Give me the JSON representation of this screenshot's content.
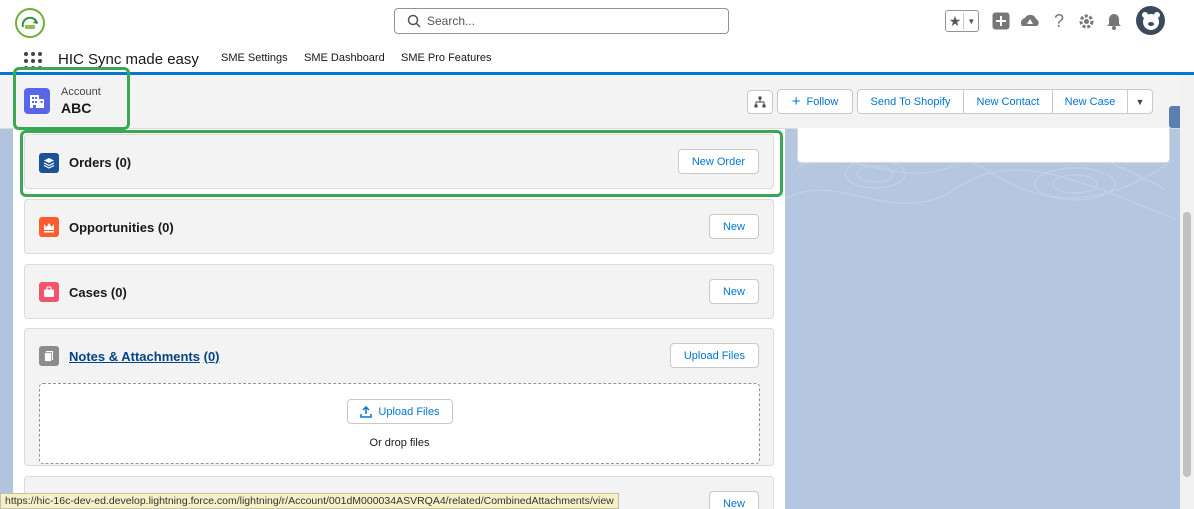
{
  "search": {
    "placeholder": "Search..."
  },
  "app": {
    "name": "HIC Sync made easy",
    "nav_items": [
      "SME Settings",
      "SME Dashboard",
      "SME Pro Features"
    ]
  },
  "record": {
    "type": "Account",
    "name": "ABC",
    "actions": {
      "follow": "Follow",
      "group": [
        "Send To Shopify",
        "New Contact",
        "New Case"
      ]
    }
  },
  "related": {
    "orders": {
      "title": "Orders (0)",
      "button": "New Order"
    },
    "opportunities": {
      "title": "Opportunities (0)",
      "button": "New"
    },
    "cases": {
      "title": "Cases (0)",
      "button": "New"
    },
    "notes": {
      "title": "Notes & Attachments",
      "count": "(0)",
      "button": "Upload Files",
      "dropzone_button": "Upload Files",
      "dropzone_text": "Or drop files"
    },
    "next": {
      "button": "New"
    }
  },
  "status_url": "https://hic-16c-dev-ed.develop.lightning.force.com/lightning/r/Account/001dM000034ASVRQA4/related/CombinedAttachments/view",
  "colors": {
    "brand_blue": "#0176d3",
    "account_icon": "#5867e8",
    "orders_icon": "#1b5297",
    "opportunities_icon": "#fc5c2e",
    "cases_icon": "#f2536d",
    "notes_icon": "#8c8c8c",
    "highlight": "#3aa755"
  }
}
